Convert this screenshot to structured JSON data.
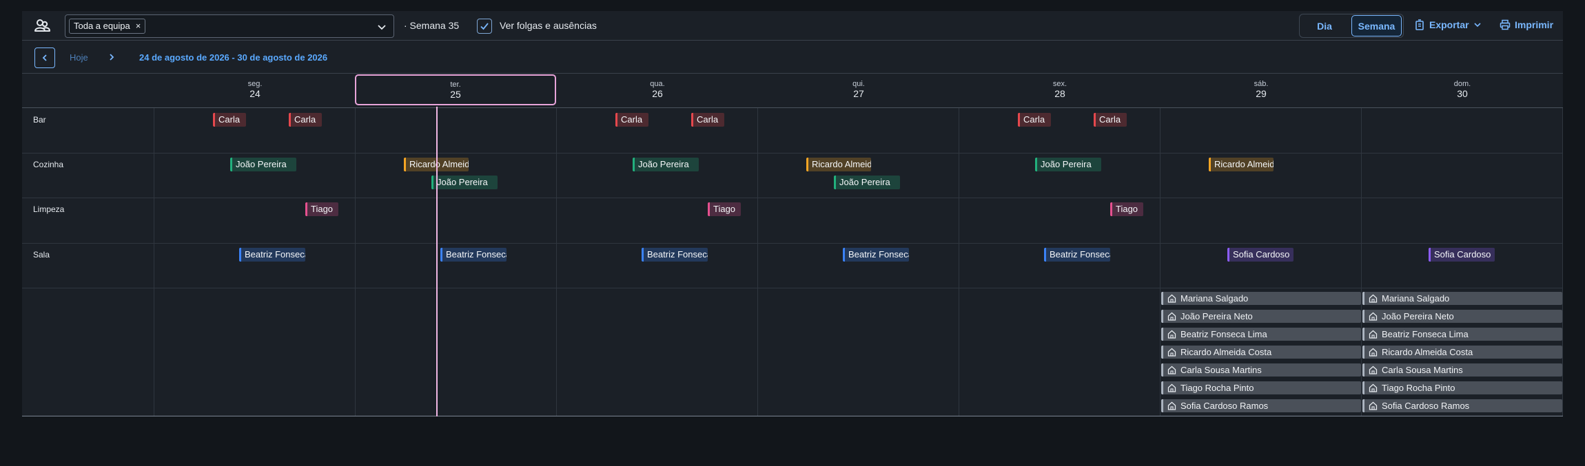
{
  "toolbar": {
    "team_token": "Toda a equipa",
    "token_close": "×",
    "week_label": "· Semana 35",
    "absences_checkbox_label": "Ver folgas e ausências",
    "view_day": "Dia",
    "view_week": "Semana",
    "export_label": "Exportar",
    "print_label": "Imprimir"
  },
  "nav": {
    "today": "Hoje",
    "range": "24 de agosto de 2026 - 30 de agosto de 2026"
  },
  "days": [
    {
      "name": "seg.",
      "num": "24"
    },
    {
      "name": "ter.",
      "num": "25"
    },
    {
      "name": "qua.",
      "num": "26"
    },
    {
      "name": "qui.",
      "num": "27"
    },
    {
      "name": "sex.",
      "num": "28"
    },
    {
      "name": "sáb.",
      "num": "29"
    },
    {
      "name": "dom.",
      "num": "30"
    }
  ],
  "rows": [
    "Bar",
    "Cozinha",
    "Limpeza",
    "Sala"
  ],
  "colors": {
    "bar": "#e5484d",
    "cozinha_ricardo": "#f5a524",
    "cozinha_joao": "#22b07d",
    "limpeza": "#e5508f",
    "sala_beatriz": "#3b82f6",
    "sala_sofia": "#8b5cf6",
    "accent": "#7ab8ff",
    "today_marker": "#f0b6e4"
  },
  "shifts": {
    "bar": [
      {
        "day": 0,
        "labels": [
          "Carla",
          "Carla"
        ]
      },
      {
        "day": 2,
        "labels": [
          "Carla",
          "Carla"
        ]
      },
      {
        "day": 4,
        "labels": [
          "Carla",
          "Carla"
        ]
      }
    ],
    "cozinha": [
      {
        "day": 0,
        "label": "João Pereira"
      },
      {
        "day": 1,
        "label": "Ricardo Almeida"
      },
      {
        "day": 1,
        "label": "João Pereira"
      },
      {
        "day": 2,
        "label": "João Pereira"
      },
      {
        "day": 3,
        "label": "Ricardo Almeida"
      },
      {
        "day": 3,
        "label": "João Pereira"
      },
      {
        "day": 4,
        "label": "João Pereira"
      },
      {
        "day": 5,
        "label": "Ricardo Almeida"
      }
    ],
    "limpeza": [
      {
        "day": 0,
        "label": "Tiago"
      },
      {
        "day": 2,
        "label": "Tiago"
      },
      {
        "day": 4,
        "label": "Tiago"
      }
    ],
    "sala": [
      {
        "day": 0,
        "label": "Beatriz Fonseca"
      },
      {
        "day": 1,
        "label": "Beatriz Fonseca"
      },
      {
        "day": 2,
        "label": "Beatriz Fonseca"
      },
      {
        "day": 3,
        "label": "Beatriz Fonseca"
      },
      {
        "day": 4,
        "label": "Beatriz Fonseca"
      },
      {
        "day": 5,
        "label": "Sofia Cardoso"
      },
      {
        "day": 6,
        "label": "Sofia Cardoso"
      }
    ]
  },
  "absences": [
    "Mariana Salgado",
    "João Pereira Neto",
    "Beatriz Fonseca Lima",
    "Ricardo Almeida Costa",
    "Carla Sousa Martins",
    "Tiago Rocha Pinto",
    "Sofia Cardoso Ramos"
  ],
  "icons": {
    "team": "team-icon",
    "chevron_down": "chevron-down-icon",
    "check": "check-icon",
    "export": "export-icon",
    "print": "printer-icon",
    "prev": "chevron-left-icon",
    "next": "chevron-right-icon",
    "home": "home-icon"
  }
}
